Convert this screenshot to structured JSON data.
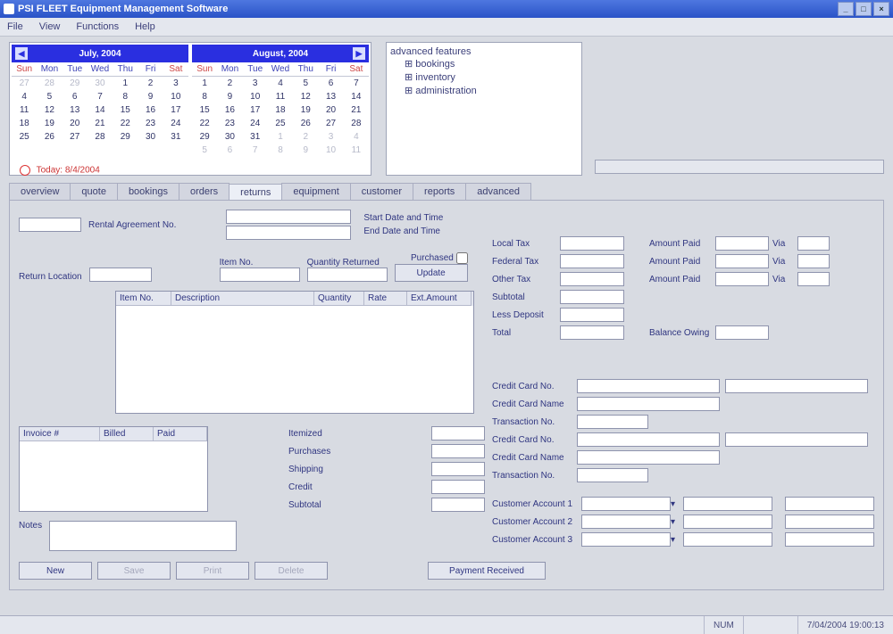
{
  "window": {
    "title": "PSI FLEET Equipment Management Software"
  },
  "menu": {
    "file": "File",
    "view": "View",
    "functions": "Functions",
    "help": "Help"
  },
  "calendar": {
    "month1": {
      "title": "July, 2004",
      "days": [
        "Sun",
        "Mon",
        "Tue",
        "Wed",
        "Thu",
        "Fri",
        "Sat"
      ],
      "cells": [
        "27",
        "28",
        "29",
        "30",
        "1",
        "2",
        "3",
        "4",
        "5",
        "6",
        "7",
        "8",
        "9",
        "10",
        "11",
        "12",
        "13",
        "14",
        "15",
        "16",
        "17",
        "18",
        "19",
        "20",
        "21",
        "22",
        "23",
        "24",
        "25",
        "26",
        "27",
        "28",
        "29",
        "30",
        "31"
      ],
      "leading_other": 4
    },
    "month2": {
      "title": "August, 2004",
      "days": [
        "Sun",
        "Mon",
        "Tue",
        "Wed",
        "Thu",
        "Fri",
        "Sat"
      ],
      "cells": [
        "1",
        "2",
        "3",
        "4",
        "5",
        "6",
        "7",
        "8",
        "9",
        "10",
        "11",
        "12",
        "13",
        "14",
        "15",
        "16",
        "17",
        "18",
        "19",
        "20",
        "21",
        "22",
        "23",
        "24",
        "25",
        "26",
        "27",
        "28",
        "29",
        "30",
        "31",
        "1",
        "2",
        "3",
        "4",
        "5",
        "6",
        "7",
        "8",
        "9",
        "10",
        "11"
      ],
      "trailing_other": 11
    },
    "today_label": "Today: 8/4/2004"
  },
  "tree": {
    "root": "advanced features",
    "items": [
      "bookings",
      "inventory",
      "administration"
    ]
  },
  "tabs": {
    "items": [
      "overview",
      "quote",
      "bookings",
      "orders",
      "returns",
      "equipment",
      "customer",
      "reports",
      "advanced"
    ],
    "active_index": 4
  },
  "returns": {
    "rental_agreement_label": "Rental Agreement No.",
    "start_label": "Start Date and Time",
    "end_label": "End Date and Time",
    "item_no_label": "Item No.",
    "qty_ret_label": "Quantity Returned",
    "purchased": "Purchased",
    "update_btn": "Update",
    "return_location_label": "Return Location",
    "grid_cols": [
      "Item No.",
      "Description",
      "Quantity",
      "Rate",
      "Ext.Amount"
    ],
    "inv_grid_cols": [
      "Invoice #",
      "Billed",
      "Paid"
    ],
    "side_labels": [
      "Itemized",
      "Purchases",
      "Shipping",
      "Credit",
      "Subtotal"
    ],
    "totals": {
      "local_tax": "Local Tax",
      "federal_tax": "Federal Tax",
      "other_tax": "Other Tax",
      "subtotal": "Subtotal",
      "less_deposit": "Less Deposit",
      "total": "Total",
      "amount_paid": "Amount Paid",
      "via": "Via",
      "balance_owing": "Balance Owing"
    },
    "cc": {
      "no": "Credit Card No.",
      "name": "Credit Card Name",
      "trans": "Transaction No."
    },
    "acct": {
      "a1": "Customer Account 1",
      "a2": "Customer Account 2",
      "a3": "Customer Account 3"
    },
    "notes_label": "Notes",
    "buttons": {
      "new": "New",
      "save": "Save",
      "print": "Print",
      "delete": "Delete",
      "payment": "Payment Received"
    }
  },
  "status": {
    "num": "NUM",
    "datetime": "7/04/2004 19:00:13"
  }
}
